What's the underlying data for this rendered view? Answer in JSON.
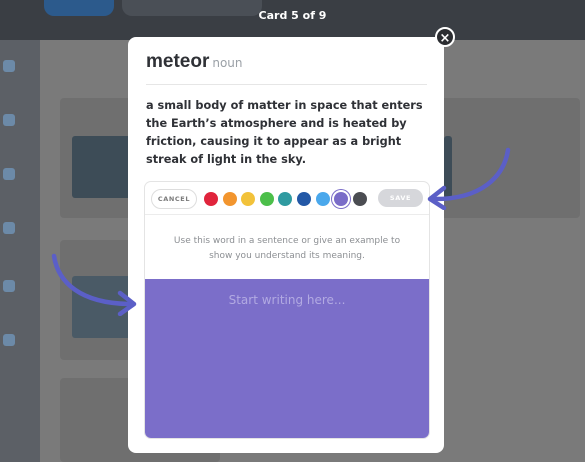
{
  "header": {
    "card_counter": "Card 5 of 9"
  },
  "card": {
    "word": "meteor",
    "part_of_speech": "noun",
    "definition": "a small body of matter in space that enters the Earth’s atmosphere and is heated by friction, causing it to appear as a bright streak of light in the sky."
  },
  "editor": {
    "cancel_label": "CANCEL",
    "save_label": "SAVE",
    "colors": [
      "#e0243c",
      "#f2952e",
      "#f2c23a",
      "#4cbf4a",
      "#2f9aa0",
      "#2358a6",
      "#4aa8ec",
      "#7a6cc8",
      "#4b4d52"
    ],
    "selected_color_index": 7,
    "prompt": "Use this word in a sentence or give an example to show you understand its meaning.",
    "placeholder": "Start writing here...",
    "writing_area_color": "#7b6ec9"
  },
  "icons": {
    "close": "close-icon",
    "arrow_right": "curved-arrow-right-icon",
    "arrow_left": "curved-arrow-left-icon"
  },
  "colors": {
    "arrow": "#5b5fc7",
    "modal": "#ffffff"
  }
}
